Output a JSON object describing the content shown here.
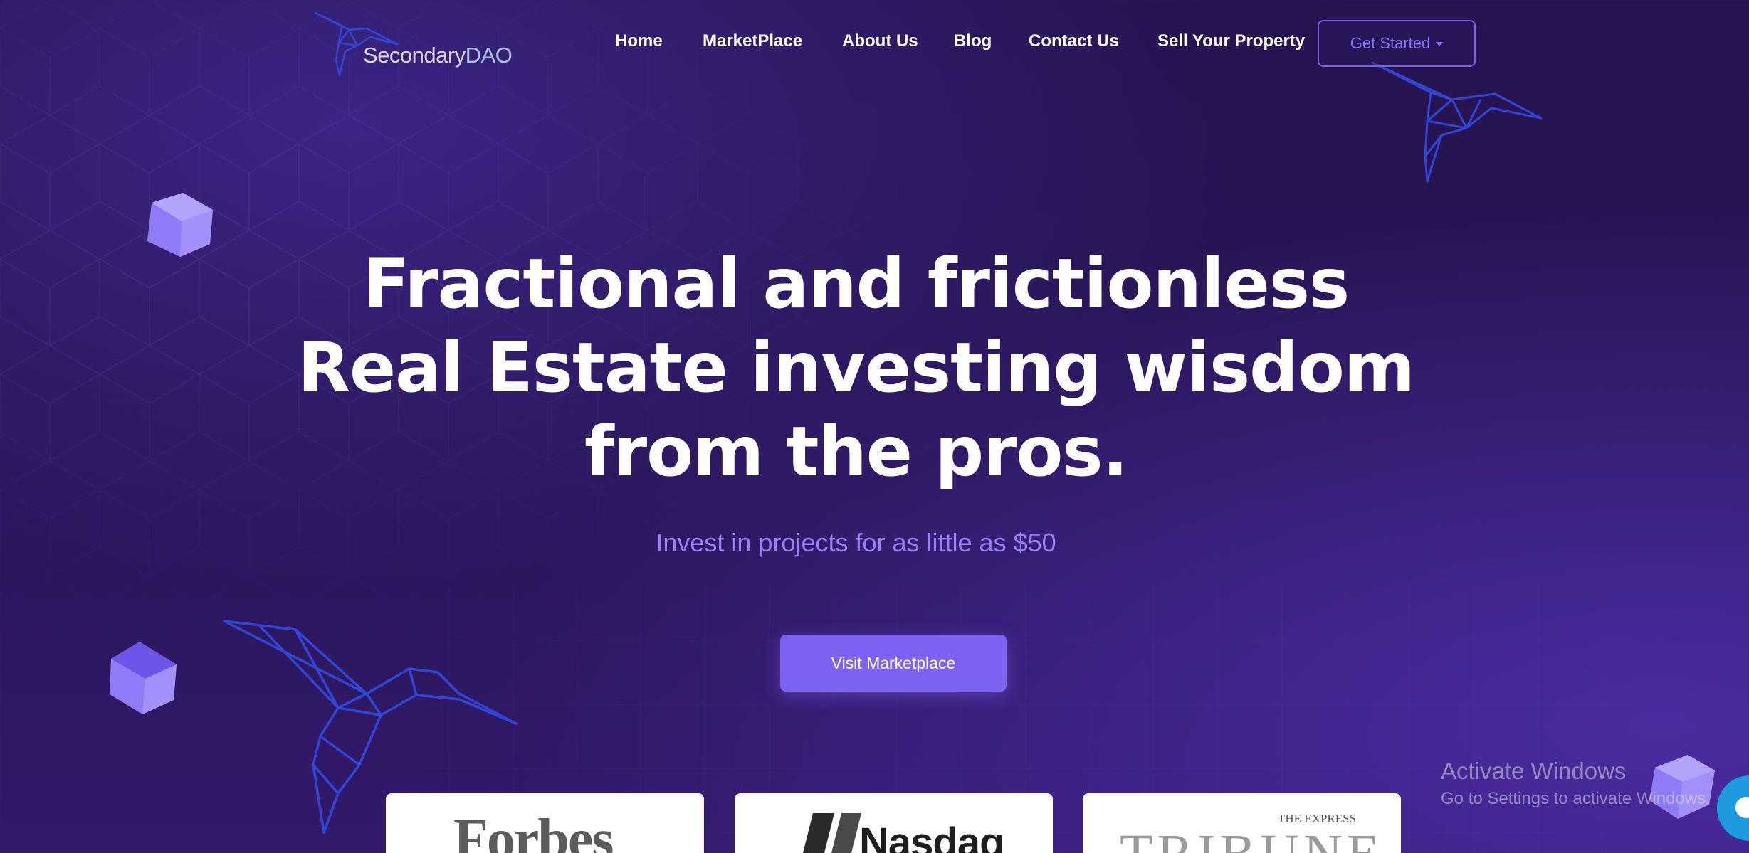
{
  "brand": {
    "name_part1": "Secondary",
    "name_part2": "DAO",
    "logo_icon": "hummingbird-icon"
  },
  "nav": {
    "items": [
      {
        "label": "Home"
      },
      {
        "label": "MarketPlace"
      },
      {
        "label": "About Us"
      },
      {
        "label": "Blog"
      },
      {
        "label": "Contact Us"
      },
      {
        "label": "Sell Your Property"
      }
    ],
    "get_started_label": "Get Started",
    "get_started_icon": "caret-down-icon"
  },
  "hero": {
    "title_lines": [
      "Fractional and frictionless",
      "Real Estate investing wisdom",
      "from the pros."
    ],
    "subtitle": "Invest in projects for as little as $50",
    "cta_label": "Visit Marketplace"
  },
  "press": {
    "forbes": "Forbes",
    "nasdaq": "Nasdaq",
    "tribune_top": "THE EXPRESS",
    "tribune": "TRIBUNE"
  },
  "watermark": {
    "line1": "Activate Windows",
    "line2": "Go to Settings to activate Windows."
  },
  "colors": {
    "background": "#26134f",
    "accent": "#7e62f2",
    "subtitle": "#9b7ef8",
    "bird": "#2f46d6",
    "cube": "#8f7bf6"
  }
}
